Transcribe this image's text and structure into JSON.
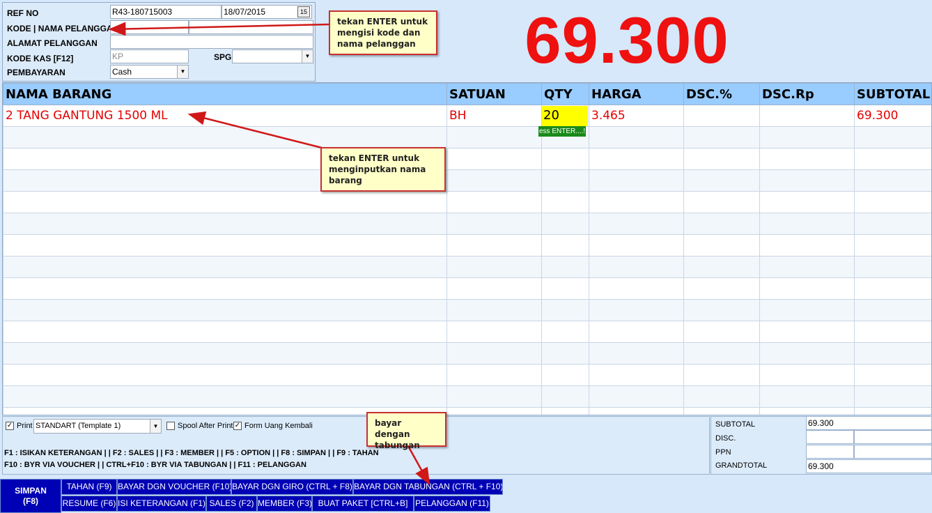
{
  "header": {
    "ref_no_label": "REF NO",
    "ref_no_value": "R43-180715003",
    "date_value": "18/07/2015",
    "calendar_icon_text": "15",
    "kode_label": "KODE | NAMA PELANGGAN",
    "kode_value": "",
    "nama_value": "",
    "alamat_label": "ALAMAT PELANGGAN",
    "alamat_value": "",
    "kode_kas_label": "KODE KAS [F12]",
    "kode_kas_value": "KP",
    "spg_label": "SPG",
    "spg_value": "",
    "pembayaran_label": "PEMBAYARAN",
    "pembayaran_value": "Cash"
  },
  "big_total": "69.300",
  "grid": {
    "columns": [
      "NAMA BARANG",
      "SATUAN",
      "QTY",
      "HARGA",
      "DSC.%",
      "DSC.Rp",
      "SUBTOTAL"
    ],
    "rows": [
      [
        "2 TANG GANTUNG 1500 ML",
        "BH",
        "20",
        "3.465",
        "",
        "",
        "69.300"
      ]
    ],
    "qty_hint": "ess ENTER....!"
  },
  "footer": {
    "print_label": "Print",
    "print_checked": true,
    "template_value": "STANDART (Template 1)",
    "spool_label": "Spool After Print",
    "spool_checked": false,
    "form_uang_label": "Form Uang Kembali",
    "form_uang_checked": true,
    "shortcuts_line1": "F1 : ISIKAN KETERANGAN | | F2 : SALES | | F3 : MEMBER | | F5 : OPTION  | | F8 : SIMPAN | | F9 : TAHAN",
    "shortcuts_line2": "F10 : BYR VIA VOUCHER | | CTRL+F10 : BYR VIA TABUNGAN  | | F11 : PELANGGAN"
  },
  "totals": {
    "subtotal_label": "SUBTOTAL",
    "subtotal_value": "69.300",
    "disc_label": "DISC.",
    "ppn_label": "PPN",
    "grandtotal_label": "GRANDTOTAL",
    "grandtotal_value": "69.300"
  },
  "buttons": {
    "simpan": "SIMPAN\n(F8)",
    "row1": [
      "TAHAN (F9)",
      "BAYAR DGN VOUCHER (F10)",
      "BAYAR DGN GIRO (CTRL + F8)",
      "BAYAR DGN TABUNGAN (CTRL + F10)"
    ],
    "row2": [
      "RESUME (F6)",
      "ISI KETERANGAN (F1)",
      "SALES (F2)",
      "MEMBER (F3)",
      "BUAT PAKET [CTRL+B]",
      "PELANGGAN (F11)"
    ]
  },
  "callouts": {
    "pelanggan": "tekan ENTER untuk\nmengisi kode dan\nnama pelanggan",
    "barang": "tekan ENTER untuk\nmenginputkan nama\nbarang",
    "tabungan": "bayar dengan\ntabungan"
  },
  "colors": {
    "total_red": "#ef1010",
    "grid_header": "#99ccff",
    "item_red": "#e30000",
    "button_blue": "#0000b4",
    "qty_yellow": "#ffff00",
    "callout_fill": "#ffffc8",
    "arrow_red": "#d01818"
  }
}
